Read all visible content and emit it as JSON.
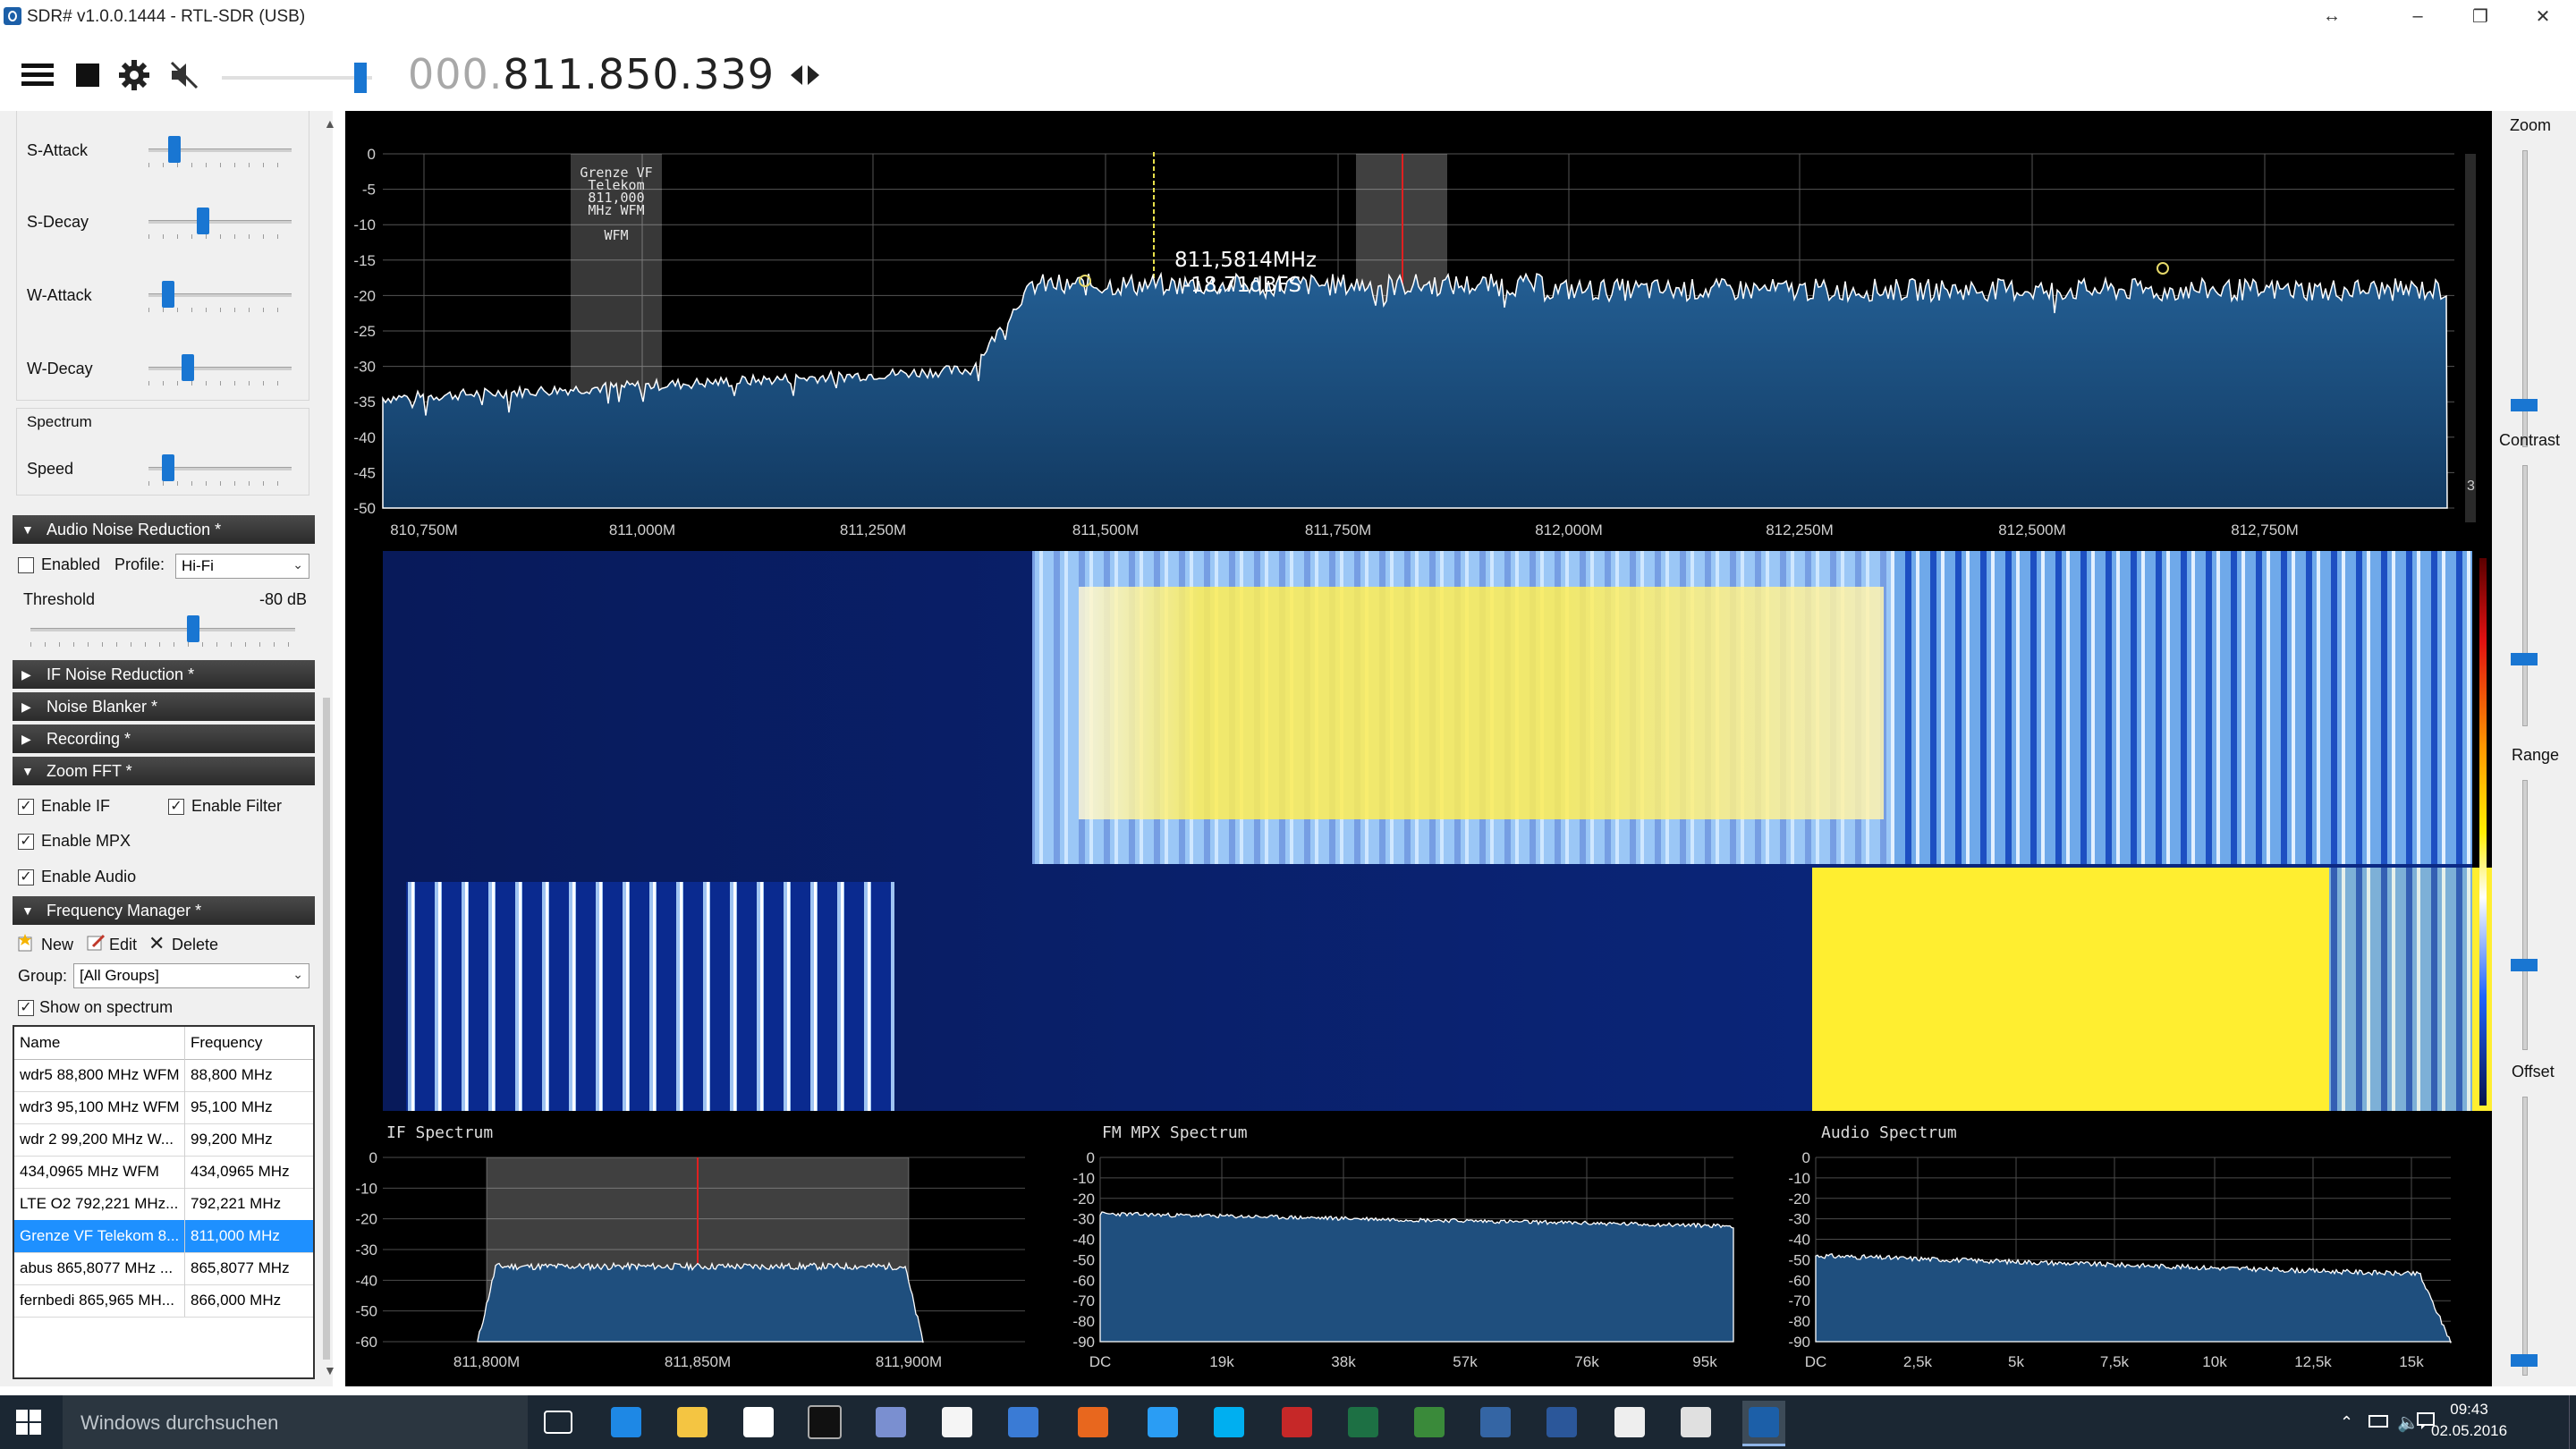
{
  "window": {
    "title": "SDR# v1.0.0.1444 - RTL-SDR (USB)",
    "controls": [
      "minimize",
      "maximize",
      "close"
    ]
  },
  "toolbar": {
    "frequency_dim": "000.",
    "frequency": "811.850.339",
    "volume_level": 0.88,
    "icons": [
      "menu-icon",
      "stop-icon",
      "settings-icon",
      "mute-icon",
      "tune-arrows-icon"
    ]
  },
  "left_panel": {
    "agc": {
      "items": [
        {
          "label": "S-Attack",
          "value": 0.15
        },
        {
          "label": "S-Decay",
          "value": 0.37
        },
        {
          "label": "W-Attack",
          "value": 0.1
        },
        {
          "label": "W-Decay",
          "value": 0.25
        }
      ]
    },
    "spectrum": {
      "title": "Spectrum",
      "speed_label": "Speed",
      "speed_value": 0.1
    },
    "audio_noise_reduction": {
      "header": "Audio Noise Reduction *",
      "enabled_label": "Enabled",
      "enabled": false,
      "profile_label": "Profile:",
      "profile_value": "Hi-Fi",
      "threshold_label": "Threshold",
      "threshold_value": "-80 dB",
      "threshold_level": 0.62
    },
    "collapsed_sections": [
      {
        "label": "IF Noise Reduction *"
      },
      {
        "label": "Noise Blanker *"
      },
      {
        "label": "Recording *"
      }
    ],
    "zoom_fft": {
      "header": "Zoom FFT *",
      "enable_if_label": "Enable IF",
      "enable_filter_label": "Enable Filter",
      "enable_mpx_label": "Enable MPX",
      "enable_audio_label": "Enable Audio"
    },
    "frequency_manager": {
      "header": "Frequency Manager *",
      "new_label": "New",
      "edit_label": "Edit",
      "delete_label": "Delete",
      "group_label": "Group:",
      "group_value": "[All Groups]",
      "show_on_spectrum_label": "Show on spectrum",
      "columns": [
        "Name",
        "Frequency"
      ],
      "rows": [
        {
          "name": "wdr5 88,800 MHz WFM",
          "freq": "88,800 MHz"
        },
        {
          "name": "wdr3 95,100 MHz WFM",
          "freq": "95,100 MHz"
        },
        {
          "name": "wdr 2 99,200 MHz W...",
          "freq": "99,200 MHz"
        },
        {
          "name": "434,0965 MHz WFM",
          "freq": "434,0965 MHz"
        },
        {
          "name": "LTE O2 792,221 MHz...",
          "freq": "792,221 MHz"
        },
        {
          "name": "Grenze VF Telekom 8...",
          "freq": "811,000 MHz",
          "selected": true
        },
        {
          "name": "abus 865,8077 MHz ...",
          "freq": "865,8077 MHz"
        },
        {
          "name": "fernbedi 865,965 MH...",
          "freq": "866,000 MHz"
        }
      ]
    }
  },
  "spectrum": {
    "y_ticks": [
      "0",
      "-5",
      "-10",
      "-15",
      "-20",
      "-25",
      "-30",
      "-35",
      "-40",
      "-45",
      "-50"
    ],
    "x_ticks": [
      "810,750M",
      "811,000M",
      "811,250M",
      "811,500M",
      "811,750M",
      "812,000M",
      "812,250M",
      "812,500M",
      "812,750M"
    ],
    "marker_freq": "811,5814MHz",
    "marker_level": "-18,71dBFS",
    "bookmark_lines": [
      "Grenze VF",
      "Telekom",
      "811,000",
      "MHz WFM",
      "",
      "WFM"
    ],
    "scroll_value": "3",
    "colors": {
      "fill": "#1a4f80",
      "trace": "#ffffff",
      "grid": "#555555"
    }
  },
  "panels": {
    "if": {
      "title": "IF Spectrum",
      "y_ticks": [
        "0",
        "-10",
        "-20",
        "-30",
        "-40",
        "-50",
        "-60"
      ],
      "x_ticks": [
        "811,800M",
        "811,850M",
        "811,900M"
      ]
    },
    "mpx": {
      "title": "FM MPX Spectrum",
      "y_ticks": [
        "0",
        "-10",
        "-20",
        "-30",
        "-40",
        "-50",
        "-60",
        "-70",
        "-80",
        "-90"
      ],
      "x_ticks": [
        "DC",
        "19k",
        "38k",
        "57k",
        "76k",
        "95k"
      ]
    },
    "audio": {
      "title": "Audio Spectrum",
      "y_ticks": [
        "0",
        "-10",
        "-20",
        "-30",
        "-40",
        "-50",
        "-60",
        "-70",
        "-80",
        "-90"
      ],
      "x_ticks": [
        "DC",
        "2,5k",
        "5k",
        "7,5k",
        "10k",
        "12,5k",
        "15k"
      ]
    }
  },
  "right_strip": {
    "zoom_label": "Zoom",
    "contrast_label": "Contrast",
    "range_label": "Range",
    "offset_label": "Offset"
  },
  "taskbar": {
    "search_placeholder": "Windows durchsuchen",
    "time": "09:43",
    "date": "02.05.2016"
  }
}
